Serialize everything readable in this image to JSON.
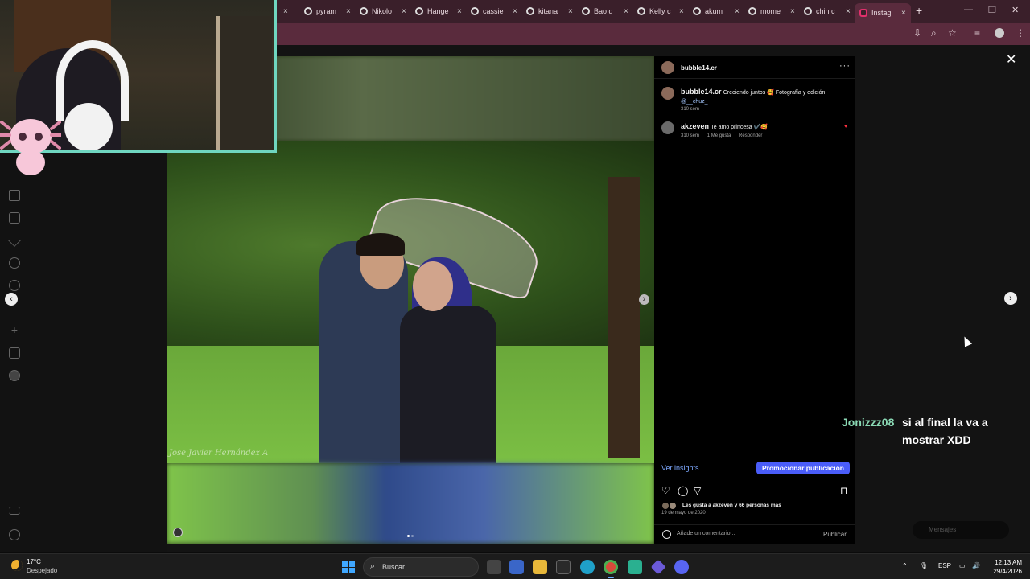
{
  "browser": {
    "tabs": [
      {
        "label": ""
      },
      {
        "label": "pyram"
      },
      {
        "label": "Nikolo"
      },
      {
        "label": "Hange"
      },
      {
        "label": "cassie"
      },
      {
        "label": "kitana"
      },
      {
        "label": "Bao d"
      },
      {
        "label": "Kelly c"
      },
      {
        "label": "akum"
      },
      {
        "label": "mome"
      },
      {
        "label": "chin c"
      },
      {
        "label": "Instag",
        "active": true
      }
    ],
    "new_tab": "+",
    "close": "×",
    "minimize": "—",
    "maximize": "❐",
    "window_close": "✕"
  },
  "post": {
    "username": "bubble14.cr",
    "more": "···",
    "caption_user": "bubble14.cr",
    "caption_text": "Creciendo juntos 🥰 Fotografía y edición:",
    "caption_mention": "@__chuz_",
    "caption_time": "310 sem",
    "comment_user": "akzeven",
    "comment_text": "Te amo princesa ✔️🥰",
    "comment_time": "310 sem",
    "comment_likes": "1 Me gusta",
    "comment_reply": "Responder",
    "insights_label": "Ver insights",
    "promote_label": "Promocionar publicación",
    "likes_text": "Les gusta a akzeven y 66 personas más",
    "date": "19 de mayo de 2020",
    "comment_placeholder": "Añade un comentario...",
    "publish_label": "Publicar",
    "watermark": "Jose Javier Hernández A"
  },
  "chat": {
    "user": "Jonizzz08",
    "message": "si al final la va a mostrar XDD"
  },
  "messages_label": "Mensajes",
  "taskbar": {
    "temperature": "17°C",
    "condition": "Despejado",
    "search_label": "Buscar",
    "lang": "ESP",
    "time": "12:13 AM",
    "date": "29/4/2026"
  },
  "colors": {
    "tab_bar": "#3a1f2a",
    "address_bar": "#5a2b3d",
    "promote_button": "#4a5df9",
    "chat_user": "#8ad9b4",
    "webcam_border": "#6fd6c0"
  }
}
